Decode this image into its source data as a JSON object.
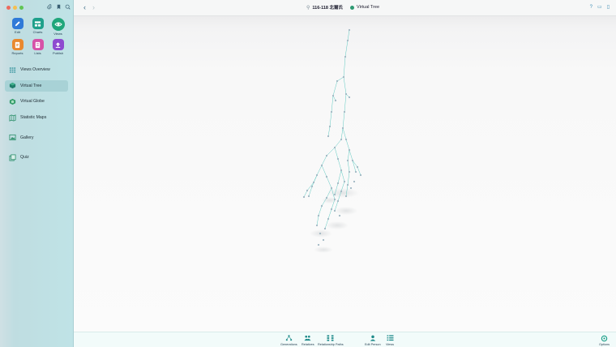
{
  "window": {
    "breadcrumb_person": "116-118 北爾氏",
    "breadcrumb_view": "Virtual Tree"
  },
  "modules": [
    {
      "label": "Edit",
      "color": "#2f7ad8",
      "icon": "pencil-icon"
    },
    {
      "label": "Charts",
      "color": "#1ea08a",
      "icon": "chart-grid-icon"
    },
    {
      "label": "Views",
      "color": "#1fa67a",
      "icon": "eye-icon"
    },
    {
      "label": "Reports",
      "color": "#e9892f",
      "icon": "report-icon"
    },
    {
      "label": "Lists",
      "color": "#d653a8",
      "icon": "list-icon"
    },
    {
      "label": "Publish",
      "color": "#8e4bd0",
      "icon": "upload-icon"
    }
  ],
  "nav": {
    "overview": "Views Overview",
    "virtual_tree": "Virtual Tree",
    "virtual_globe": "Virtual Globe",
    "statistic_maps": "Statistic Maps",
    "gallery": "Gallery",
    "quiz": "Quiz"
  },
  "bottom": {
    "generations": "Generations",
    "relatives": "Relatives",
    "relationship_paths": "Relationship Paths",
    "edit_person": "Edit Person",
    "views": "Views",
    "options": "Options"
  },
  "colors": {
    "accent": "#1fa67a",
    "sidebar": "#bfe3e6",
    "tree_lines": "#5fc9c1"
  }
}
